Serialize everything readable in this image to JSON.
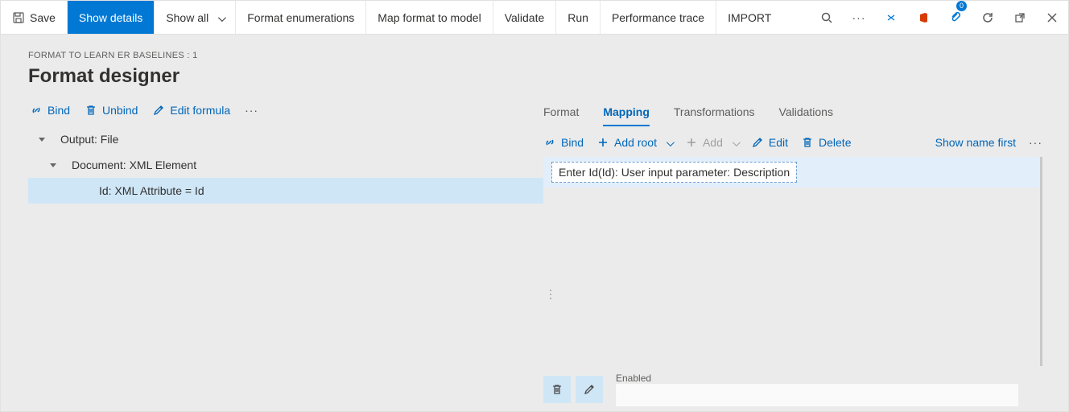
{
  "toolbar": {
    "save_label": "Save",
    "show_details_label": "Show details",
    "show_all_label": "Show all",
    "format_enum_label": "Format enumerations",
    "map_format_label": "Map format to model",
    "validate_label": "Validate",
    "run_label": "Run",
    "perf_trace_label": "Performance trace",
    "import_label": "IMPORT",
    "badge_count": "0"
  },
  "header": {
    "breadcrumb": "FORMAT TO LEARN ER BASELINES : 1",
    "title": "Format designer"
  },
  "left_actions": {
    "bind_label": "Bind",
    "unbind_label": "Unbind",
    "edit_formula_label": "Edit formula"
  },
  "tree": {
    "node0": "Output: File",
    "node1": "Document: XML Element",
    "node2": "Id: XML Attribute = Id"
  },
  "tabs": {
    "format": "Format",
    "mapping": "Mapping",
    "transformations": "Transformations",
    "validations": "Validations"
  },
  "right_actions": {
    "bind_label": "Bind",
    "add_root_label": "Add root",
    "add_label": "Add",
    "edit_label": "Edit",
    "delete_label": "Delete",
    "show_name_first_label": "Show name first"
  },
  "mapping": {
    "row0": "Enter Id(Id): User input parameter: Description"
  },
  "bottom": {
    "enabled_label": "Enabled"
  }
}
